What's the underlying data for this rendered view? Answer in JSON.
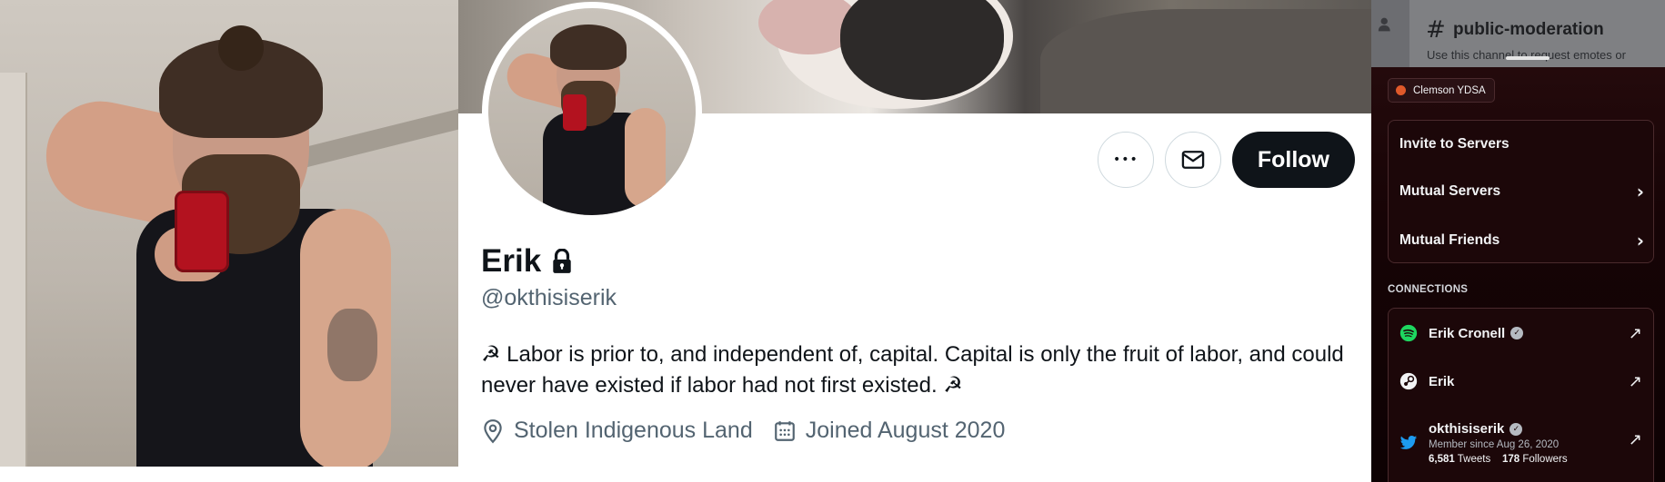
{
  "twitter_profile": {
    "name": "Erik",
    "handle": "@okthisiserik",
    "bio": "☭ Labor is prior to, and independent of, capital. Capital is only the fruit of labor, and could never have existed if labor had not first existed. ☭",
    "location": "Stolen Indigenous Land",
    "joined": "Joined August 2020",
    "follow_label": "Follow",
    "more_label": "•••"
  },
  "discord": {
    "channel_hash": "#",
    "channel_name": "public-moderation",
    "channel_topic": "Use this channel to request emotes or",
    "server_badge": "Clemson YDSA",
    "menu": [
      {
        "label": "Invite to Servers",
        "chevron": ""
      },
      {
        "label": "Mutual Servers",
        "chevron": "›"
      },
      {
        "label": "Mutual Friends",
        "chevron": "›"
      }
    ],
    "connections_heading": "CONNECTIONS",
    "connections": [
      {
        "service": "spotify",
        "name": "Erik Cronell",
        "verified": true
      },
      {
        "service": "steam",
        "name": "Erik",
        "verified": false
      },
      {
        "service": "twitter",
        "name": "okthisiserik",
        "verified": true,
        "member_since": "Member since Aug 26, 2020",
        "tweets_count": "6,581",
        "tweets_label": "Tweets",
        "followers_count": "178",
        "followers_label": "Followers"
      }
    ],
    "verified_glyph": "✓",
    "external_glyph": "↗"
  },
  "colors": {
    "twitter_text": "#0f1419",
    "twitter_muted": "#536471",
    "follow_bg": "#0f1419",
    "spotify_green": "#1ed760",
    "twitter_blue": "#1d9bf0",
    "badge_dot": "#e0592a"
  }
}
